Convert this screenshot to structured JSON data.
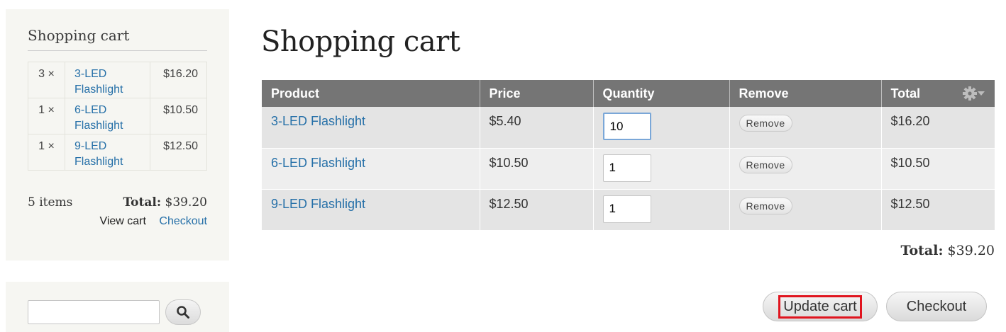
{
  "sidebar": {
    "title": "Shopping cart",
    "items": [
      {
        "qty": "3 ×",
        "name": "3-LED Flashlight",
        "price": "$16.20"
      },
      {
        "qty": "1 ×",
        "name": "6-LED Flashlight",
        "price": "$10.50"
      },
      {
        "qty": "1 ×",
        "name": "9-LED Flashlight",
        "price": "$12.50"
      }
    ],
    "item_count": "5 items",
    "total_label": "Total:",
    "total_value": "$39.20",
    "view_cart": "View cart",
    "checkout": "Checkout"
  },
  "search": {
    "value": "",
    "button_icon": "search-icon"
  },
  "main": {
    "title": "Shopping cart",
    "columns": [
      "Product",
      "Price",
      "Quantity",
      "Remove",
      "Total"
    ],
    "settings_icon": "gear-icon",
    "rows": [
      {
        "product": "3-LED Flashlight",
        "price": "$5.40",
        "quantity": "10",
        "remove": "Remove",
        "total": "$16.20"
      },
      {
        "product": "6-LED Flashlight",
        "price": "$10.50",
        "quantity": "1",
        "remove": "Remove",
        "total": "$10.50"
      },
      {
        "product": "9-LED Flashlight",
        "price": "$12.50",
        "quantity": "1",
        "remove": "Remove",
        "total": "$12.50"
      }
    ],
    "total_label": "Total:",
    "total_value": "$39.20",
    "update_cart": "Update cart",
    "checkout": "Checkout"
  },
  "colors": {
    "link": "#2670a8",
    "header_bg": "#757575",
    "highlight": "#e0141e"
  }
}
